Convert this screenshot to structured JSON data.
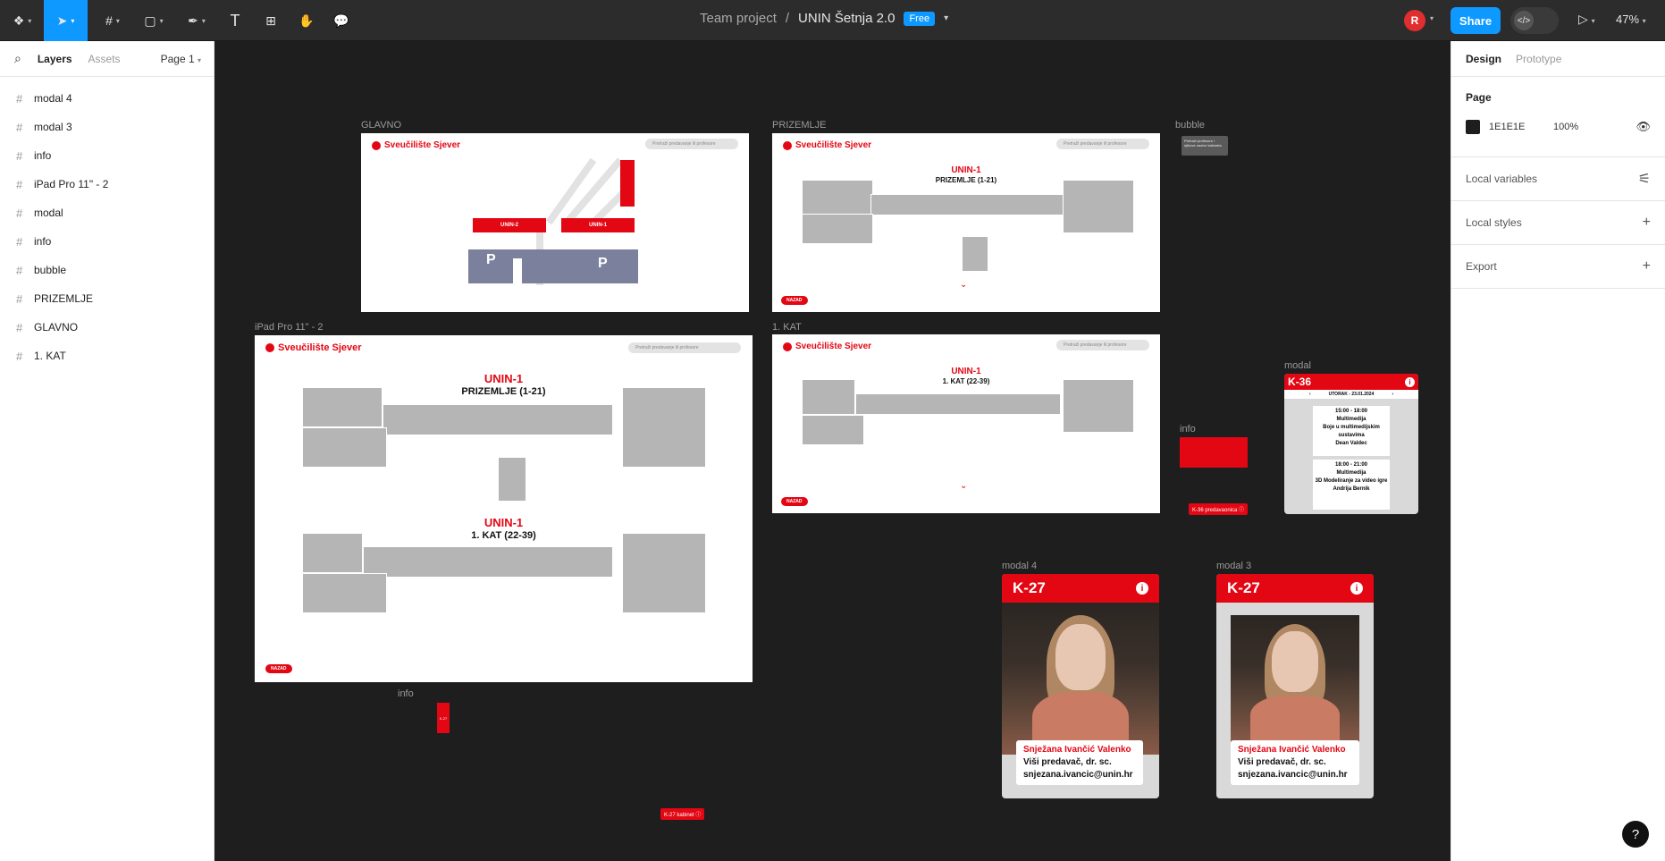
{
  "toolbar": {
    "tools": [
      "main-menu",
      "move",
      "frame",
      "shape",
      "pen",
      "text",
      "resources",
      "hand",
      "comment"
    ]
  },
  "header": {
    "team": "Team project",
    "separator": "/",
    "file": "UNIN Šetnja 2.0",
    "plan_badge": "Free",
    "avatar_initial": "R",
    "share_label": "Share",
    "devmode_label": "</>",
    "zoom": "47%"
  },
  "left_panel": {
    "tab_layers": "Layers",
    "tab_assets": "Assets",
    "page_select": "Page 1",
    "layers": [
      "modal 4",
      "modal 3",
      "info",
      "iPad Pro 11\" - 2",
      "modal",
      "info",
      "bubble",
      "PRIZEMLJE",
      "GLAVNO",
      "1. KAT"
    ]
  },
  "right_panel": {
    "tab_design": "Design",
    "tab_prototype": "Prototype",
    "page_heading": "Page",
    "bg_hex": "1E1E1E",
    "bg_opacity": "100%",
    "local_variables": "Local variables",
    "local_styles": "Local styles",
    "export": "Export"
  },
  "canvas": {
    "labels": {
      "glavno": "GLAVNO",
      "prizemlje": "PRIZEMLJE",
      "bubble": "bubble",
      "ipad": "iPad Pro 11\" - 2",
      "kat": "1. KAT",
      "modal": "modal",
      "info1": "info",
      "info2": "info",
      "modal4": "modal 4",
      "modal3": "modal 3"
    },
    "brand": "Sveučilište Sjever",
    "search_placeholder": "Pretraži predavanje ili profesore",
    "back": "NAZAD",
    "unin1": "UNIN-1",
    "unin2": "UNIN-2",
    "prizemlje_sub": "PRIZEMLJE (1-21)",
    "kat_sub": "1. KAT (22-39)",
    "parking": "P",
    "bubble_text": "Pretraži profesore i njihove nazive kabineta",
    "k36_pred": "K-36 predavaonica",
    "k27_kab": "K-27 kabinet",
    "k27_small": "K-27",
    "schedule": {
      "room": "K-36",
      "date": "UTORAK - 23.01.2024",
      "slots": [
        {
          "time": "15:00 - 18:00",
          "course": "Multimedija",
          "title": "Boje u multimedijskim sustavima",
          "lecturer": "Dean Valdec"
        },
        {
          "time": "18:00 - 21:00",
          "course": "Multimedija",
          "title": "3D Modeliranje za video igre",
          "lecturer": "Andrija Bernik"
        }
      ]
    },
    "profile": {
      "room": "K-27",
      "name": "Snježana Ivančić Valenko",
      "title": "Viši predavač, dr. sc.",
      "email": "snjezana.ivancic@unin.hr"
    }
  }
}
